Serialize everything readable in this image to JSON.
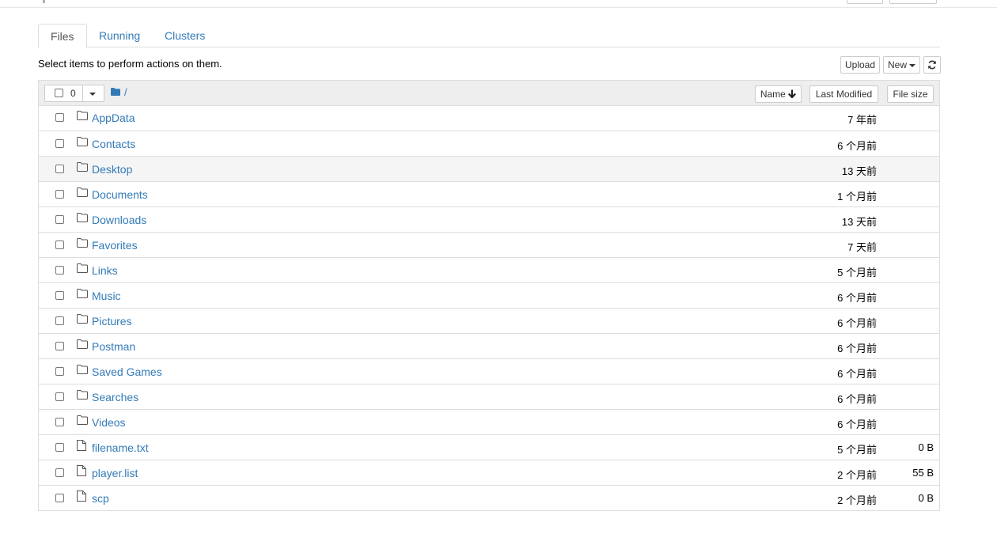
{
  "tabs": [
    {
      "label": "Files",
      "active": true
    },
    {
      "label": "Running",
      "active": false
    },
    {
      "label": "Clusters",
      "active": false
    }
  ],
  "hint": "Select items to perform actions on them.",
  "toolbar": {
    "upload_label": "Upload",
    "new_label": "New",
    "refresh_icon": "refresh-icon"
  },
  "list_header": {
    "selected_count": "0",
    "breadcrumb": "/",
    "sort_name_label": "Name",
    "sort_name_icon": "arrow-down-icon",
    "last_modified_label": "Last Modified",
    "file_size_label": "File size"
  },
  "items": [
    {
      "type": "folder",
      "name": "AppData",
      "modified": "7 年前",
      "size": ""
    },
    {
      "type": "folder",
      "name": "Contacts",
      "modified": "6 个月前",
      "size": ""
    },
    {
      "type": "folder",
      "name": "Desktop",
      "modified": "13 天前",
      "size": ""
    },
    {
      "type": "folder",
      "name": "Documents",
      "modified": "1 个月前",
      "size": ""
    },
    {
      "type": "folder",
      "name": "Downloads",
      "modified": "13 天前",
      "size": ""
    },
    {
      "type": "folder",
      "name": "Favorites",
      "modified": "7 天前",
      "size": ""
    },
    {
      "type": "folder",
      "name": "Links",
      "modified": "5 个月前",
      "size": ""
    },
    {
      "type": "folder",
      "name": "Music",
      "modified": "6 个月前",
      "size": ""
    },
    {
      "type": "folder",
      "name": "Pictures",
      "modified": "6 个月前",
      "size": ""
    },
    {
      "type": "folder",
      "name": "Postman",
      "modified": "6 个月前",
      "size": ""
    },
    {
      "type": "folder",
      "name": "Saved Games",
      "modified": "6 个月前",
      "size": ""
    },
    {
      "type": "folder",
      "name": "Searches",
      "modified": "6 个月前",
      "size": ""
    },
    {
      "type": "folder",
      "name": "Videos",
      "modified": "6 个月前",
      "size": ""
    },
    {
      "type": "file",
      "name": "filename.txt",
      "modified": "5 个月前",
      "size": "0 B"
    },
    {
      "type": "file",
      "name": "player.list",
      "modified": "2 个月前",
      "size": "55 B"
    },
    {
      "type": "file",
      "name": "scp",
      "modified": "2 个月前",
      "size": "0 B"
    }
  ],
  "colors": {
    "link": "#337ab7",
    "header_bg": "#eeeeee",
    "hover_row": "#f5f5f5"
  }
}
